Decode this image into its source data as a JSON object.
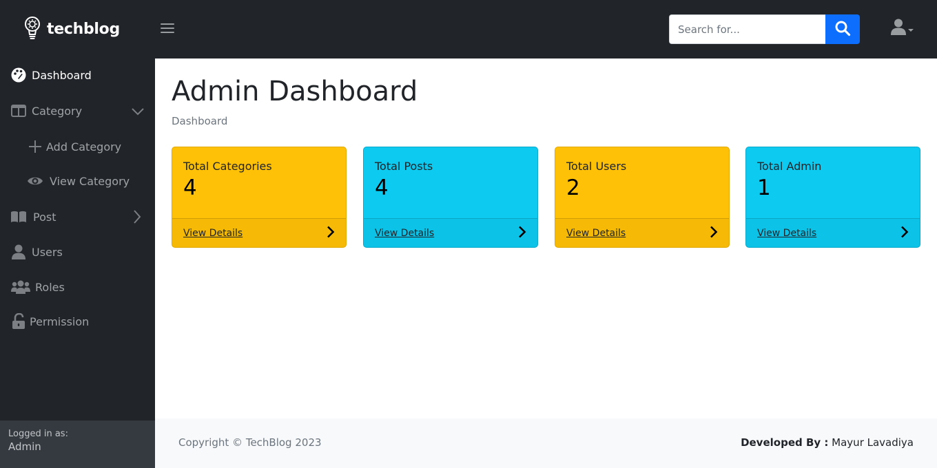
{
  "brand": {
    "name": "techblog",
    "icon": "lightbulb-icon"
  },
  "search": {
    "placeholder": "Search for...",
    "value": ""
  },
  "sidebar": {
    "items": [
      {
        "label": "Dashboard",
        "icon": "palette-icon",
        "active": true
      },
      {
        "label": "Category",
        "icon": "columns-icon",
        "caret": "chevron-down-icon"
      },
      {
        "label": "Add Category",
        "icon": "plus-icon"
      },
      {
        "label": "View Category",
        "icon": "eye-icon"
      },
      {
        "label": "Post",
        "icon": "book-icon",
        "caret": "chevron-right-icon"
      },
      {
        "label": "Users",
        "icon": "user-icon"
      },
      {
        "label": "Roles",
        "icon": "users-icon"
      },
      {
        "label": "Permission",
        "icon": "lock-open-icon"
      }
    ],
    "footer": {
      "label": "Logged in as:",
      "user": "Admin"
    }
  },
  "main": {
    "title": "Admin Dashboard",
    "breadcrumb": "Dashboard",
    "cards": [
      {
        "title": "Total Categories",
        "count": "4",
        "link": "View Details",
        "color": "#ffc107"
      },
      {
        "title": "Total Posts",
        "count": "4",
        "link": "View Details",
        "color": "#0dcaf0"
      },
      {
        "title": "Total Users",
        "count": "2",
        "link": "View Details",
        "color": "#ffc107"
      },
      {
        "title": "Total Admin",
        "count": "1",
        "link": "View Details",
        "color": "#0dcaf0"
      }
    ]
  },
  "footer": {
    "copyright": "Copyright © TechBlog 2023",
    "developed_label": "Developed By :",
    "developer": "Mayur Lavadiya"
  },
  "colors": {
    "dark": "#212529",
    "primary": "#0d6efd",
    "warning": "#ffc107",
    "info": "#0dcaf0"
  }
}
